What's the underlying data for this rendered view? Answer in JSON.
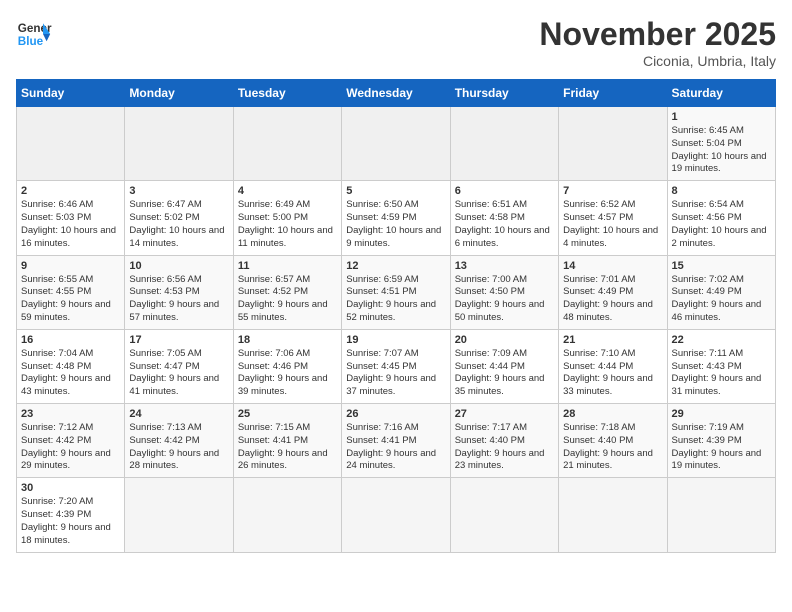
{
  "header": {
    "logo_general": "General",
    "logo_blue": "Blue",
    "month_title": "November 2025",
    "subtitle": "Ciconia, Umbria, Italy"
  },
  "days_of_week": [
    "Sunday",
    "Monday",
    "Tuesday",
    "Wednesday",
    "Thursday",
    "Friday",
    "Saturday"
  ],
  "weeks": [
    [
      {
        "day": "",
        "info": ""
      },
      {
        "day": "",
        "info": ""
      },
      {
        "day": "",
        "info": ""
      },
      {
        "day": "",
        "info": ""
      },
      {
        "day": "",
        "info": ""
      },
      {
        "day": "",
        "info": ""
      },
      {
        "day": "1",
        "info": "Sunrise: 6:45 AM\nSunset: 5:04 PM\nDaylight: 10 hours and 19 minutes."
      }
    ],
    [
      {
        "day": "2",
        "info": "Sunrise: 6:46 AM\nSunset: 5:03 PM\nDaylight: 10 hours and 16 minutes."
      },
      {
        "day": "3",
        "info": "Sunrise: 6:47 AM\nSunset: 5:02 PM\nDaylight: 10 hours and 14 minutes."
      },
      {
        "day": "4",
        "info": "Sunrise: 6:49 AM\nSunset: 5:00 PM\nDaylight: 10 hours and 11 minutes."
      },
      {
        "day": "5",
        "info": "Sunrise: 6:50 AM\nSunset: 4:59 PM\nDaylight: 10 hours and 9 minutes."
      },
      {
        "day": "6",
        "info": "Sunrise: 6:51 AM\nSunset: 4:58 PM\nDaylight: 10 hours and 6 minutes."
      },
      {
        "day": "7",
        "info": "Sunrise: 6:52 AM\nSunset: 4:57 PM\nDaylight: 10 hours and 4 minutes."
      },
      {
        "day": "8",
        "info": "Sunrise: 6:54 AM\nSunset: 4:56 PM\nDaylight: 10 hours and 2 minutes."
      }
    ],
    [
      {
        "day": "9",
        "info": "Sunrise: 6:55 AM\nSunset: 4:55 PM\nDaylight: 9 hours and 59 minutes."
      },
      {
        "day": "10",
        "info": "Sunrise: 6:56 AM\nSunset: 4:53 PM\nDaylight: 9 hours and 57 minutes."
      },
      {
        "day": "11",
        "info": "Sunrise: 6:57 AM\nSunset: 4:52 PM\nDaylight: 9 hours and 55 minutes."
      },
      {
        "day": "12",
        "info": "Sunrise: 6:59 AM\nSunset: 4:51 PM\nDaylight: 9 hours and 52 minutes."
      },
      {
        "day": "13",
        "info": "Sunrise: 7:00 AM\nSunset: 4:50 PM\nDaylight: 9 hours and 50 minutes."
      },
      {
        "day": "14",
        "info": "Sunrise: 7:01 AM\nSunset: 4:49 PM\nDaylight: 9 hours and 48 minutes."
      },
      {
        "day": "15",
        "info": "Sunrise: 7:02 AM\nSunset: 4:49 PM\nDaylight: 9 hours and 46 minutes."
      }
    ],
    [
      {
        "day": "16",
        "info": "Sunrise: 7:04 AM\nSunset: 4:48 PM\nDaylight: 9 hours and 43 minutes."
      },
      {
        "day": "17",
        "info": "Sunrise: 7:05 AM\nSunset: 4:47 PM\nDaylight: 9 hours and 41 minutes."
      },
      {
        "day": "18",
        "info": "Sunrise: 7:06 AM\nSunset: 4:46 PM\nDaylight: 9 hours and 39 minutes."
      },
      {
        "day": "19",
        "info": "Sunrise: 7:07 AM\nSunset: 4:45 PM\nDaylight: 9 hours and 37 minutes."
      },
      {
        "day": "20",
        "info": "Sunrise: 7:09 AM\nSunset: 4:44 PM\nDaylight: 9 hours and 35 minutes."
      },
      {
        "day": "21",
        "info": "Sunrise: 7:10 AM\nSunset: 4:44 PM\nDaylight: 9 hours and 33 minutes."
      },
      {
        "day": "22",
        "info": "Sunrise: 7:11 AM\nSunset: 4:43 PM\nDaylight: 9 hours and 31 minutes."
      }
    ],
    [
      {
        "day": "23",
        "info": "Sunrise: 7:12 AM\nSunset: 4:42 PM\nDaylight: 9 hours and 29 minutes."
      },
      {
        "day": "24",
        "info": "Sunrise: 7:13 AM\nSunset: 4:42 PM\nDaylight: 9 hours and 28 minutes."
      },
      {
        "day": "25",
        "info": "Sunrise: 7:15 AM\nSunset: 4:41 PM\nDaylight: 9 hours and 26 minutes."
      },
      {
        "day": "26",
        "info": "Sunrise: 7:16 AM\nSunset: 4:41 PM\nDaylight: 9 hours and 24 minutes."
      },
      {
        "day": "27",
        "info": "Sunrise: 7:17 AM\nSunset: 4:40 PM\nDaylight: 9 hours and 23 minutes."
      },
      {
        "day": "28",
        "info": "Sunrise: 7:18 AM\nSunset: 4:40 PM\nDaylight: 9 hours and 21 minutes."
      },
      {
        "day": "29",
        "info": "Sunrise: 7:19 AM\nSunset: 4:39 PM\nDaylight: 9 hours and 19 minutes."
      }
    ],
    [
      {
        "day": "30",
        "info": "Sunrise: 7:20 AM\nSunset: 4:39 PM\nDaylight: 9 hours and 18 minutes."
      },
      {
        "day": "",
        "info": ""
      },
      {
        "day": "",
        "info": ""
      },
      {
        "day": "",
        "info": ""
      },
      {
        "day": "",
        "info": ""
      },
      {
        "day": "",
        "info": ""
      },
      {
        "day": "",
        "info": ""
      }
    ]
  ]
}
